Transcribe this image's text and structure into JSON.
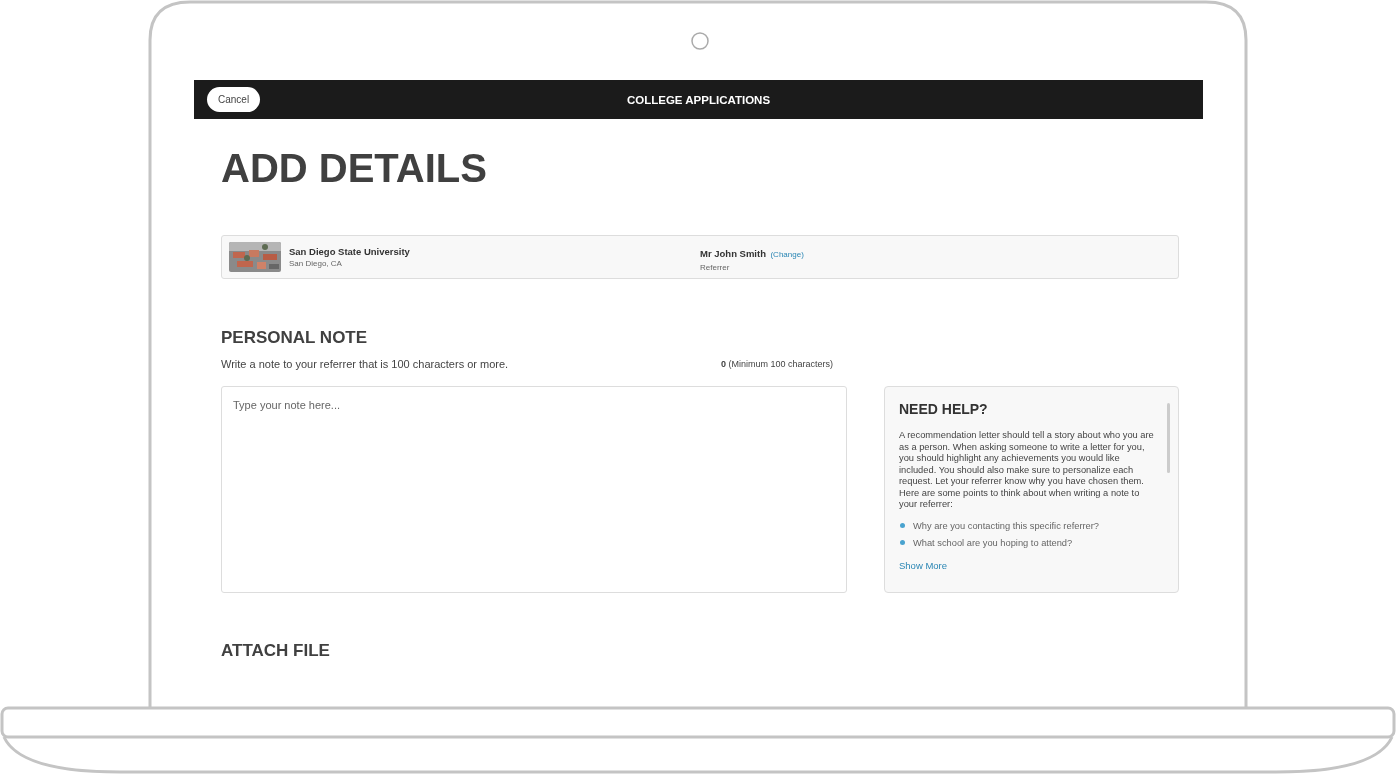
{
  "top_bar": {
    "cancel_button": "Cancel",
    "title": "COLLEGE APPLICATIONS"
  },
  "heading": "ADD DETAILS",
  "school_card": {
    "school_name": "San Diego State University",
    "location": "San Diego, CA",
    "referrer_name": "Mr John Smith",
    "change_link": "(Change)",
    "referrer_role": "Referrer"
  },
  "personal_note": {
    "title": "PERSONAL NOTE",
    "description": "Write a note to your referrer that is 100 characters or more.",
    "counter": "**0** (Minimum 100 characters)",
    "note_field": {
      "placeholder": "Type your note here..."
    }
  },
  "help_panel": {
    "title": "NEED HELP?",
    "body": "A recommendation letter should tell a story about who you are as a person. When asking someone to write a letter for you, you should highlight any achievements you would like included. You should also make sure to personalize each request. Let your referrer know why you have chosen them. Here are some points to think about when writing a note to your referrer:",
    "points": [
      "Why are you contacting this specific referrer?",
      "What school are you hoping to attend?"
    ],
    "show_more_link": "Show More"
  },
  "attach_file": {
    "title": "ATTACH FILE"
  }
}
